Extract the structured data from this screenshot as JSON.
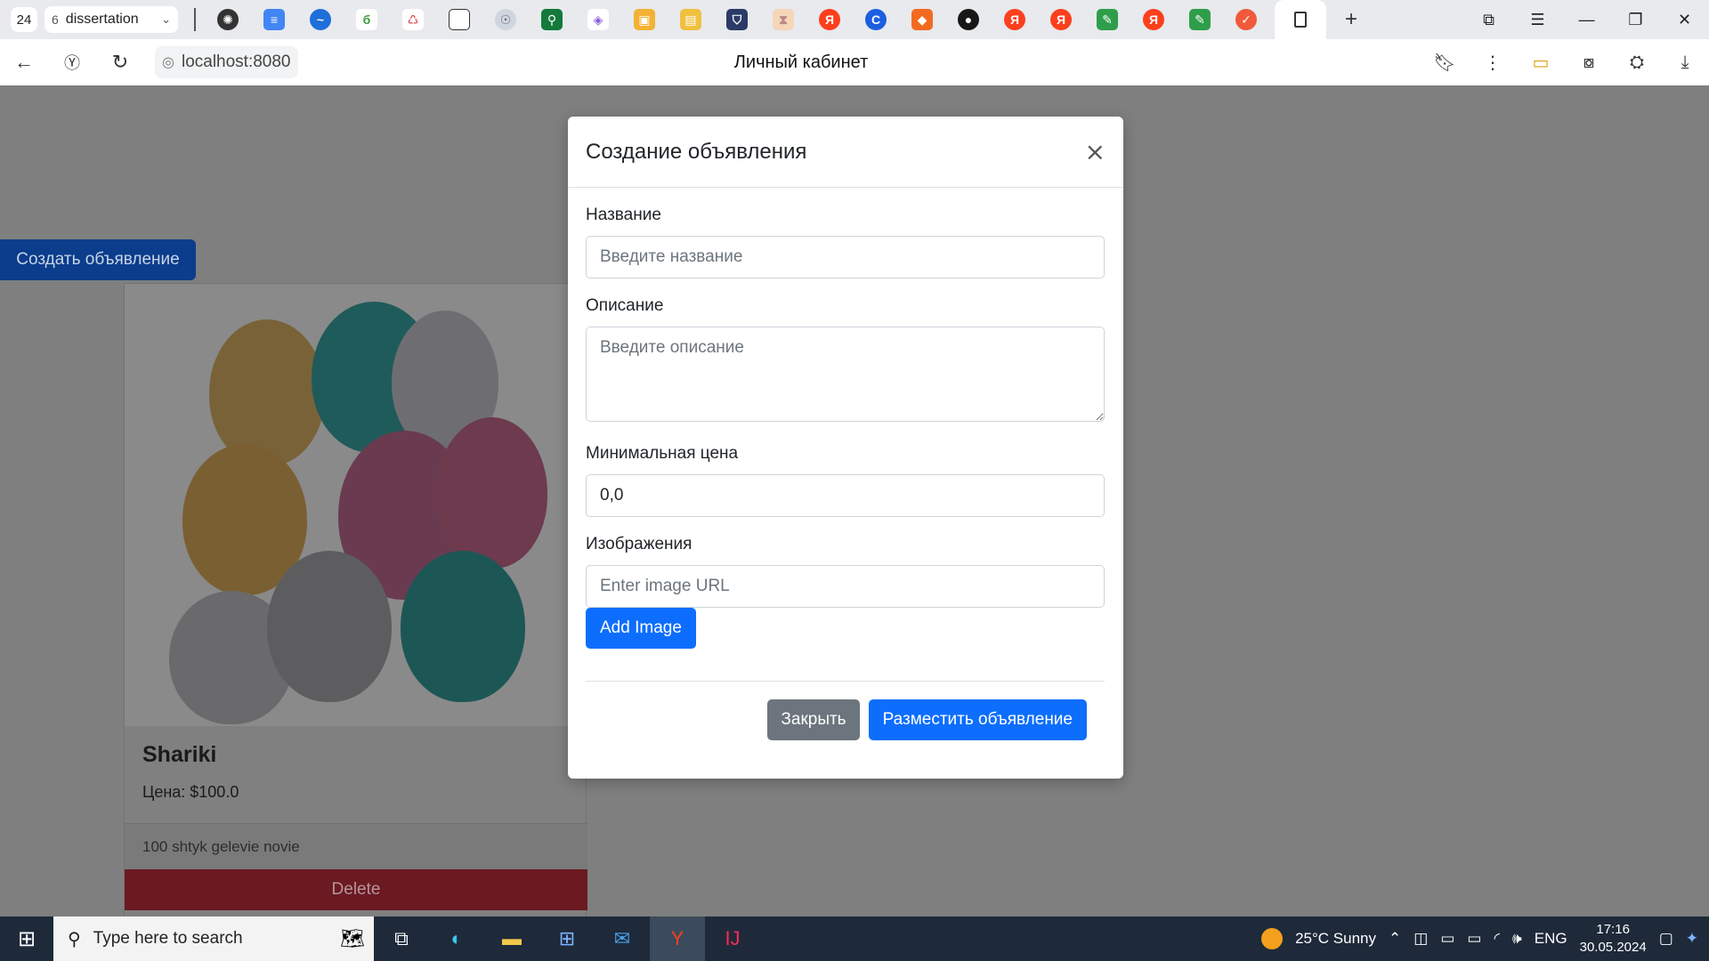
{
  "browser": {
    "tab_count": "24",
    "tab_group": {
      "count": "6",
      "name": "dissertation"
    },
    "url": "localhost:8080",
    "page_title": "Личный кабинет"
  },
  "page": {
    "create_button": "Создать объявление",
    "card": {
      "title": "Shariki",
      "price": "Цена: $100.0",
      "description": "100 shtyk gelevie novie",
      "delete_label": "Delete"
    }
  },
  "modal": {
    "title": "Создание объявления",
    "close_glyph": "×",
    "name_label": "Название",
    "name_placeholder": "Введите название",
    "description_label": "Описание",
    "description_placeholder": "Введите описание",
    "min_price_label": "Минимальная цена",
    "min_price_value": "0,0",
    "images_label": "Изображения",
    "image_url_placeholder": "Enter image URL",
    "add_image_label": "Add Image",
    "close_label": "Закрыть",
    "submit_label": "Разместить объявление"
  },
  "taskbar": {
    "search_placeholder": "Type here to search",
    "weather": "25°C  Sunny",
    "language": "ENG",
    "time": "17:16",
    "date": "30.05.2024"
  },
  "colors": {
    "primary": "#0d6efd",
    "secondary": "#6c757d",
    "danger_dimmed": "#6b1a22",
    "backdrop": "#7f7f7f"
  }
}
